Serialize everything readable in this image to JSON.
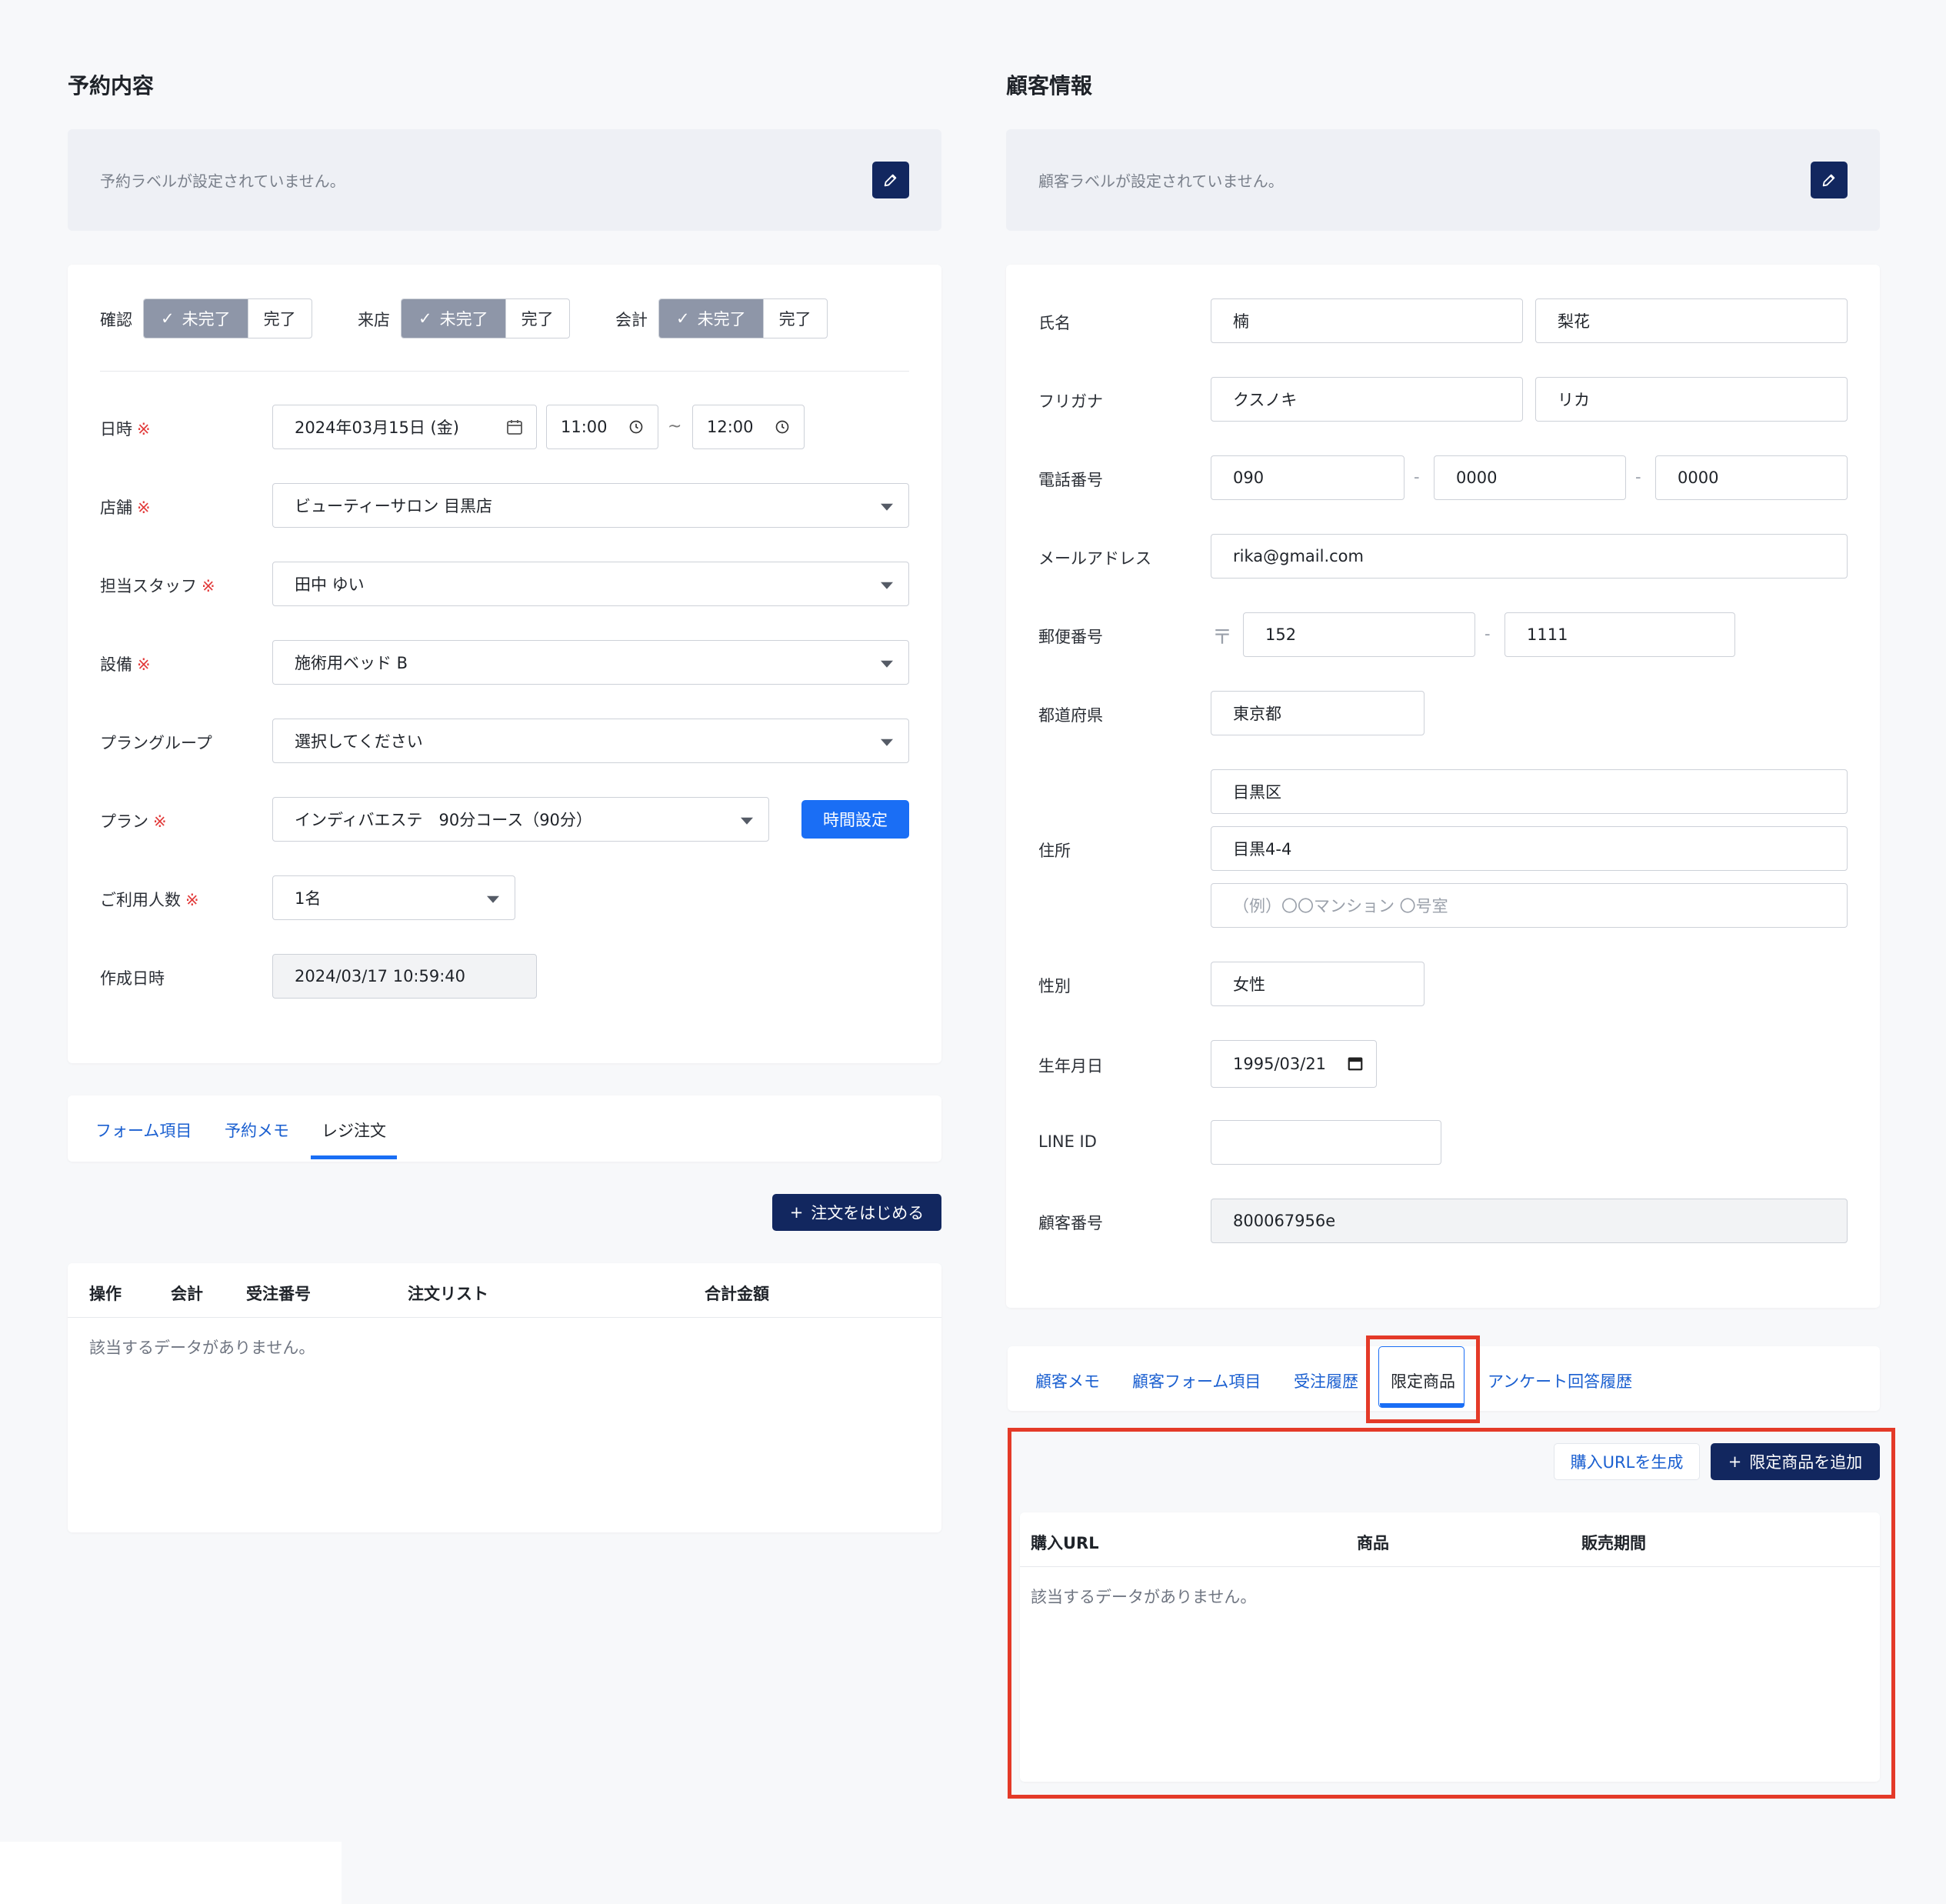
{
  "left": {
    "title": "予約内容",
    "label_text": "予約ラベルが設定されていません。",
    "status": [
      {
        "label": "確認",
        "on": "未完了",
        "off": "完了"
      },
      {
        "label": "来店",
        "on": "未完了",
        "off": "完了"
      },
      {
        "label": "会計",
        "on": "未完了",
        "off": "完了"
      }
    ],
    "fields": {
      "datetime_label": "日時",
      "date_value": "2024年03月15日 (金)",
      "start_time": "11:00",
      "tilde": "~",
      "end_time": "12:00",
      "store_label": "店舗",
      "store_value": "ビューティーサロン 目黒店",
      "staff_label": "担当スタッフ",
      "staff_value": "田中 ゆい",
      "equipment_label": "設備",
      "equipment_value": "施術用ベッド B",
      "plan_group_label": "プラングループ",
      "plan_group_value": "選択してください",
      "plan_label": "プラン",
      "plan_value": "インディバエステ　90分コース（90分）",
      "time_setting_button": "時間設定",
      "people_label": "ご利用人数",
      "people_value": "1名",
      "created_label": "作成日時",
      "created_value": "2024/03/17 10:59:40",
      "required_mark": "※"
    },
    "tabs": [
      "フォーム項目",
      "予約メモ",
      "レジ注文"
    ],
    "start_order_button": "注文をはじめる",
    "table_headers": [
      "操作",
      "会計",
      "受注番号",
      "注文リスト",
      "合計金額"
    ],
    "empty_text": "該当するデータがありません。"
  },
  "right": {
    "title": "顧客情報",
    "label_text": "顧客ラベルが設定されていません。",
    "fields": {
      "name_label": "氏名",
      "last_name": "楠",
      "first_name": "梨花",
      "kana_label": "フリガナ",
      "last_kana": "クスノキ",
      "first_kana": "リカ",
      "phone_label": "電話番号",
      "phone1": "090",
      "phone2": "0000",
      "phone3": "0000",
      "email_label": "メールアドレス",
      "email": "rika@gmail.com",
      "zip_label": "郵便番号",
      "zip_mark": "〒",
      "zip1": "152",
      "zip2": "1111",
      "pref_label": "都道府県",
      "pref": "東京都",
      "address_label": "住所",
      "address1": "目黒区",
      "address2": "目黒4-4",
      "address3_placeholder": "（例）〇〇マンション 〇号室",
      "gender_label": "性別",
      "gender": "女性",
      "birthday_label": "生年月日",
      "birthday": "1995/03/21",
      "line_label": "LINE ID",
      "line_value": "",
      "customer_no_label": "顧客番号",
      "customer_no": "800067956e",
      "dash": "-"
    },
    "tabs": [
      "顧客メモ",
      "顧客フォーム項目",
      "受注履歴",
      "限定商品",
      "アンケート回答履歴"
    ],
    "generate_url_button": "購入URLを生成",
    "add_product_button": "限定商品を追加",
    "table_headers": [
      "購入URL",
      "商品",
      "販売期間"
    ],
    "empty_text": "該当するデータがありません。"
  },
  "colors": {
    "navy": "#12275f",
    "blue": "#1a6ef5",
    "highlight_red": "#e43a28",
    "required_red": "#e23b3b"
  }
}
